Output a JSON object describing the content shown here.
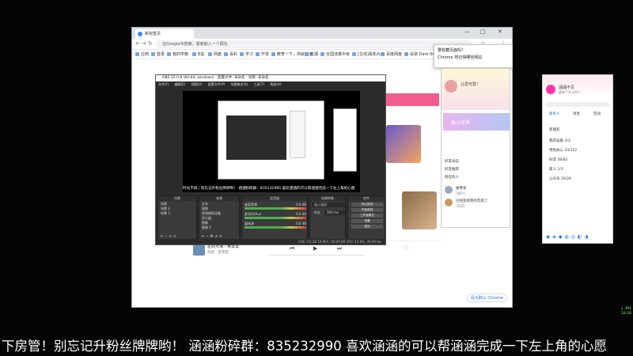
{
  "chrome": {
    "tab_title": "新标签页",
    "omnibox_placeholder": "在Google中搜索，或者输入一个网址",
    "bookmarks": [
      "应用",
      "登录",
      "我的学籍",
      "B站",
      "网盘",
      "百科",
      "学习",
      "开发",
      "教育一下，你就知道",
      "蓝湖",
      "全国流量中考",
      "[在线]看影片",
      "百度网盘",
      "谷歌 Dark theme"
    ],
    "set_default_label": "设为默认 Chrome"
  },
  "popup": {
    "title": "要收藏页面吗？",
    "text": "Chrome 将记得哪些网站"
  },
  "obs": {
    "title": "OBS 25.0.8 (64-bit, windows) - 配置文件: 未命名 - 场景: 未命名",
    "menu": [
      "文件(F)",
      "编辑(E)",
      "视图(V)",
      "配置文件(P)",
      "场景集合(S)",
      "工具(T)",
      "帮助(H)"
    ],
    "ticker": "时光不再 | 别忘记升粉丝牌牌哟！ 涵涵粉碎群：835232990 喜欢涵涵的可以帮涵涵完成一下左上角的心愿",
    "docks": {
      "scenes_title": "场景",
      "sources_title": "来源",
      "mixer_title": "混音器",
      "transitions_title": "场景转换",
      "controls_title": "控件"
    },
    "scenes": [
      "场景",
      "场景 2",
      "场景 3"
    ],
    "sources": [
      "文本",
      "图像",
      "视频捕获设备",
      "显示器",
      "图像",
      "图像 2"
    ],
    "mixer": [
      {
        "name": "桌面音频",
        "db": "0.0 dB"
      },
      {
        "name": "麦克风/Aux",
        "db": "0.0 dB"
      },
      {
        "name": "媒体源",
        "db": "0.0 dB"
      }
    ],
    "transition": "淡入淡出",
    "transition_duration_label": "时长",
    "transition_duration": "300 ms",
    "controls": [
      "停止推流",
      "开始录制",
      "工作室模式",
      "设置",
      "退出"
    ],
    "status": "LIVE: 01:28:10   REC: 00:00:00   CPU: 12.6%, 30.00 fps"
  },
  "player": {
    "song": "星辰大海 - 黄霄雲",
    "artist": "热歌 · 黄霄雲"
  },
  "qq_mid": {
    "greeting": "让爱可爱！",
    "banner": "缘分世界",
    "items": [
      "好友动态",
      "好友推荐",
      "附近的人"
    ],
    "contacts": [
      {
        "name": "被寒星",
        "msg": "[图片]"
      },
      {
        "name": "已经是爸爸的年龄了",
        "msg": "[语音]"
      }
    ]
  },
  "qq_right": {
    "name": "涵涵不见",
    "signature": "要做个开心的人",
    "tabs": [
      "联系人",
      "消息",
      "空间"
    ],
    "groups": [
      {
        "label": "新朋友",
        "count": ""
      },
      {
        "label": "我的设备",
        "count": "2/3"
      },
      {
        "label": "特别关心",
        "count": "33/152"
      },
      {
        "label": "好友",
        "count": "58/82"
      },
      {
        "label": "家人",
        "count": "1/3"
      },
      {
        "label": "公众号",
        "count": "20/28"
      }
    ]
  },
  "danmaku": "下房管！别忘记升粉丝牌牌哟！ 涵涵粉碎群：835232990 喜欢涵涵的可以帮涵涵完成一下左上角的心愿",
  "tray": {
    "line1": "↓ 391",
    "line2": "24.16"
  }
}
